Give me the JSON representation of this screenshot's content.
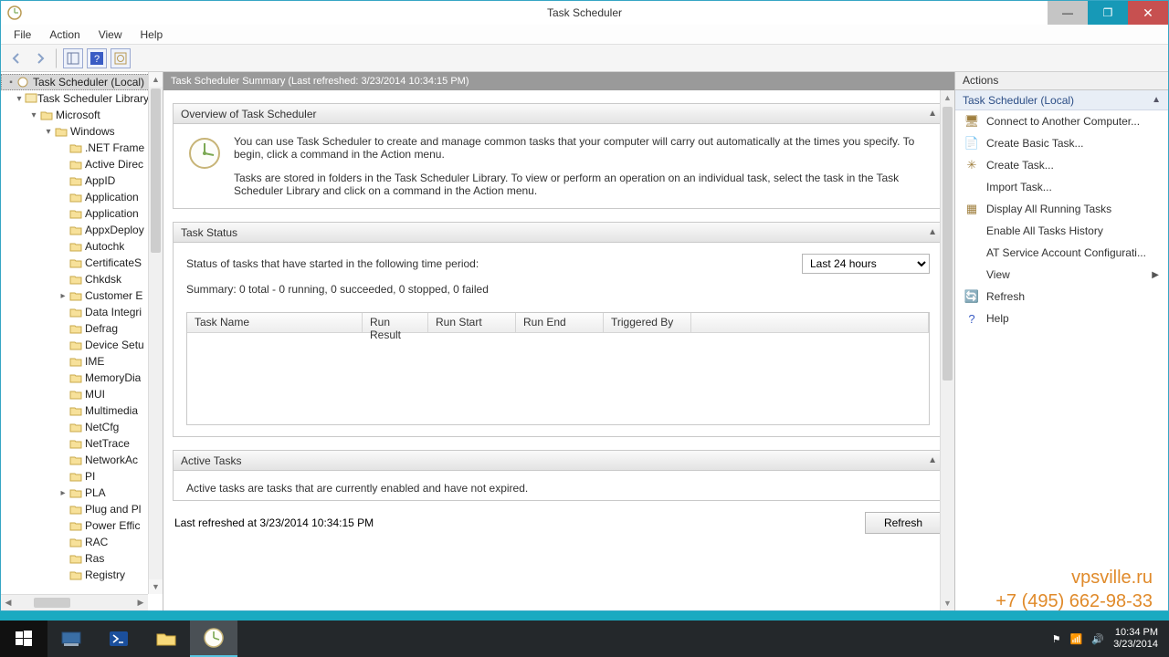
{
  "title": "Task Scheduler",
  "menubar": {
    "file": "File",
    "action": "Action",
    "view": "View",
    "help": "Help"
  },
  "tree": {
    "root": "Task Scheduler (Local)",
    "library": "Task Scheduler Library",
    "microsoft": "Microsoft",
    "windows": "Windows",
    "items": [
      ".NET Frame",
      "Active Direc",
      "AppID",
      "Application",
      "Application",
      "AppxDeploy",
      "Autochk",
      "CertificateS",
      "Chkdsk",
      "Customer E",
      "Data Integri",
      "Defrag",
      "Device Setu",
      "IME",
      "MemoryDia",
      "MUI",
      "Multimedia",
      "NetCfg",
      "NetTrace",
      "NetworkAc",
      "PI",
      "PLA",
      "Plug and Pl",
      "Power Effic",
      "RAC",
      "Ras",
      "Registry"
    ]
  },
  "center": {
    "summary_header": "Task Scheduler Summary (Last refreshed: 3/23/2014 10:34:15 PM)",
    "overview_title": "Overview of Task Scheduler",
    "overview_p1": "You can use Task Scheduler to create and manage common tasks that your computer will carry out automatically at the times you specify. To begin, click a command in the Action menu.",
    "overview_p2": "Tasks are stored in folders in the Task Scheduler Library. To view or perform an operation on an individual task, select the task in the Task Scheduler Library and click on a command in the Action menu.",
    "status_title": "Task Status",
    "status_label": "Status of tasks that have started in the following time period:",
    "period": "Last 24 hours",
    "summary": "Summary: 0 total - 0 running, 0 succeeded, 0 stopped, 0 failed",
    "cols": {
      "name": "Task Name",
      "result": "Run Result",
      "start": "Run Start",
      "end": "Run End",
      "trigger": "Triggered By"
    },
    "active_title": "Active Tasks",
    "active_desc": "Active tasks are tasks that are currently enabled and have not expired.",
    "last_refreshed": "Last refreshed at 3/23/2014 10:34:15 PM",
    "refresh": "Refresh"
  },
  "actions": {
    "header": "Actions",
    "subtitle": "Task Scheduler (Local)",
    "items": [
      "Connect to Another Computer...",
      "Create Basic Task...",
      "Create Task...",
      "Import Task...",
      "Display All Running Tasks",
      "Enable All Tasks History",
      "AT Service Account Configurati...",
      "View",
      "Refresh",
      "Help"
    ]
  },
  "tray": {
    "time": "10:34 PM",
    "date": "3/23/2014"
  },
  "watermark": {
    "l1": "vpsville.ru",
    "l2": "+7 (495) 662-98-33"
  }
}
